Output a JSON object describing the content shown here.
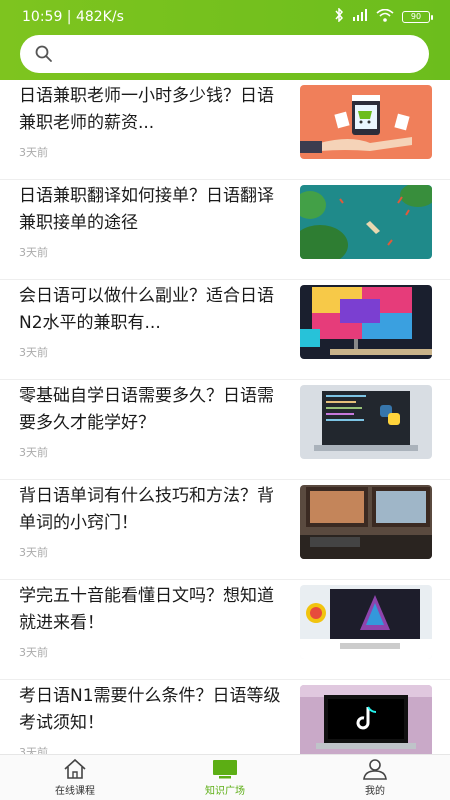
{
  "status_bar": {
    "time_speed": "10:59 | 482K/s",
    "battery": "90"
  },
  "search": {
    "placeholder": ""
  },
  "feed": {
    "items": [
      {
        "title": "日语兼职老师一小时多少钱？日语兼职老师的薪资...",
        "time": "3天前",
        "thumb": "shopping-hand-illustration"
      },
      {
        "title": "日语兼职翻译如何接单？日语翻译兼职接单的途径",
        "time": "3天前",
        "thumb": "boat-lake-aerial"
      },
      {
        "title": "会日语可以做什么副业？适合日语N2水平的兼职有...",
        "time": "3天前",
        "thumb": "colorful-monitor-desk"
      },
      {
        "title": "零基础自学日语需要多久？日语需要多久才能学好？",
        "time": "3天前",
        "thumb": "python-laptop"
      },
      {
        "title": "背日语单词有什么技巧和方法？背单词的小窍门！",
        "time": "3天前",
        "thumb": "workstation-monitors"
      },
      {
        "title": "学完五十音能看懂日文吗？想知道就进来看！",
        "time": "3天前",
        "thumb": "design-desk-monitor"
      },
      {
        "title": "考日语N1需要什么条件？日语等级考试须知！",
        "time": "3天前",
        "thumb": "tiktok-laptop"
      }
    ]
  },
  "tabbar": {
    "tabs": [
      {
        "label": "在线课程",
        "icon": "home-icon"
      },
      {
        "label": "知识广场",
        "icon": "monitor-icon"
      },
      {
        "label": "我的",
        "icon": "user-icon"
      }
    ]
  },
  "colors": {
    "brand_green": "#6cbd1d",
    "active_tab": "#5cae14"
  }
}
